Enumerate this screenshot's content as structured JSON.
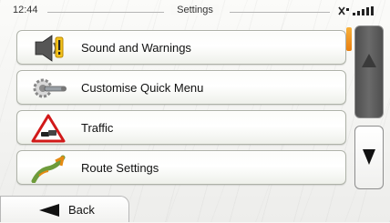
{
  "status": {
    "time": "12:44",
    "title": "Settings"
  },
  "menu": {
    "items": [
      {
        "label": "Sound and Warnings",
        "icon": "speaker-warning-icon"
      },
      {
        "label": "Customise Quick Menu",
        "icon": "gear-wrench-icon"
      },
      {
        "label": "Traffic",
        "icon": "traffic-warning-icon"
      },
      {
        "label": "Route Settings",
        "icon": "route-icon"
      }
    ]
  },
  "scroll": {
    "up_icon": "arrow-up-icon",
    "down_icon": "arrow-down-icon"
  },
  "back": {
    "label": "Back",
    "icon": "arrow-left-icon"
  },
  "colors": {
    "accent": "#f08a1a",
    "scroll_up_bg": "#5c5c5c",
    "warning_red": "#d11919"
  }
}
